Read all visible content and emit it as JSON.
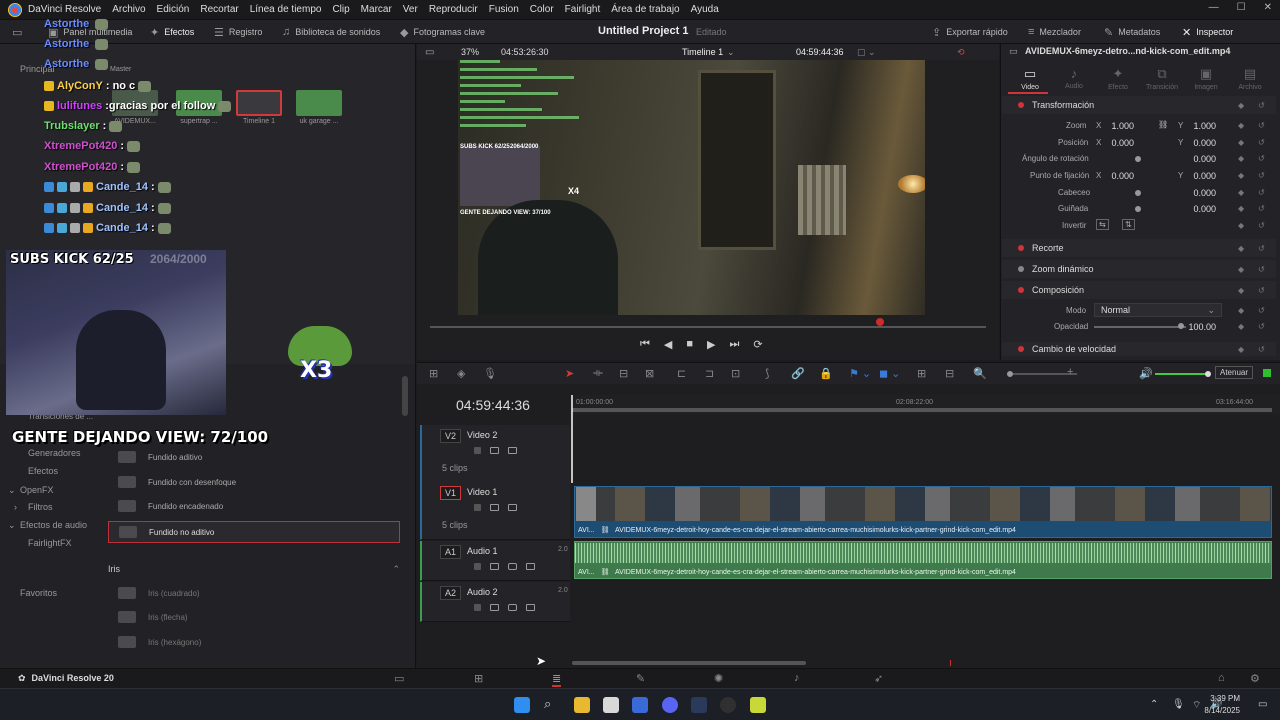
{
  "titlebar": {
    "menus": [
      "DaVinci Resolve",
      "Archivo",
      "Edición",
      "Recortar",
      "Línea de tiempo",
      "Clip",
      "Marcar",
      "Ver",
      "Reproducir",
      "Fusion",
      "Color",
      "Fairlight",
      "Área de trabajo",
      "Ayuda"
    ],
    "win_min": "—",
    "win_max": "☐",
    "win_close": "✕"
  },
  "toolbar": {
    "media_panel": "Panel multimedia",
    "effects": "Efectos",
    "register": "Registro",
    "sound_lib": "Biblioteca de sonidos",
    "keyframes": "Fotogramas clave",
    "project_title": "Untitled Project 1",
    "project_state": "Editado",
    "quick_export": "Exportar rápido",
    "mixer": "Mezclador",
    "metadata": "Metadatos",
    "inspector": "Inspector"
  },
  "media_pool": {
    "principal": "Principal",
    "master": "Master",
    "thumbs": [
      {
        "label": "AVIDEMUX...",
        "color": "#4a5a4a"
      },
      {
        "label": "supertrap ...",
        "color": "#4a8a4a"
      },
      {
        "label": "Timeline 1",
        "color": "#3a3a3e"
      },
      {
        "label": "uk garage ...",
        "color": "#4a8a4a"
      }
    ]
  },
  "chat": [
    {
      "user": "Astorthe",
      "msg": "",
      "color": "#6a8cff"
    },
    {
      "user": "Astorthe",
      "msg": "",
      "color": "#6a8cff"
    },
    {
      "user": "Astorthe",
      "msg": "",
      "color": "#6a8cff"
    },
    {
      "user": "AlyConY",
      "msg": ": no c",
      "color": "#ffd04a"
    },
    {
      "user": "lulifunes",
      "msg": ":gracias por el follow",
      "color": "#d040ff"
    },
    {
      "user": "Trubslayer",
      "msg": ":",
      "color": "#6ee06e"
    },
    {
      "user": "XtremePot420",
      "msg": ":",
      "color": "#d050d0"
    },
    {
      "user": "XtremePot420",
      "msg": ":",
      "color": "#d050d0"
    },
    {
      "user": "Cande_14",
      "msg": ":",
      "color": "#9ec2ff"
    },
    {
      "user": "Cande_14",
      "msg": ":",
      "color": "#9ec2ff"
    },
    {
      "user": "Cande_14",
      "msg": ":",
      "color": "#9ec2ff"
    }
  ],
  "webcam": {
    "subs": "SUBS KICK 62/25",
    "subs_faint": "2064/2000",
    "view": "GENTE DEJANDO VIEW: 72/100",
    "x3": "X3"
  },
  "effects": {
    "left_items": [
      "Transiciones de ...",
      "Generadores",
      "Efectos",
      "OpenFX",
      "Filtros",
      "Efectos de audio",
      "FairlightFX",
      "Favoritos"
    ],
    "transitions": [
      "Fundido aditivo",
      "Fundido con desenfoque",
      "Fundido encadenado",
      "Fundido no aditivo"
    ],
    "iris_header": "Iris",
    "iris": [
      "Iris (cuadrado)",
      "Iris (flecha)",
      "Iris (hexágono)"
    ]
  },
  "viewer": {
    "zoom": "37%",
    "timecode_left": "04:53:26:30",
    "timeline_name": "Timeline 1",
    "timecode_right": "04:59:44:36",
    "inner_subs": "SUBS KICK 62/25",
    "inner_count": "2064/2000",
    "inner_view": "GENTE DEJANDO VIEW: 37/100",
    "inner_x4": "X4",
    "scrub_fraction": 0.81
  },
  "inspector": {
    "file_name": "AVIDEMUX-6meyz-detro...nd-kick-com_edit.mp4",
    "tabs": [
      "Video",
      "Audio",
      "Efecto",
      "Transición",
      "Imagen",
      "Archivo"
    ],
    "transform": "Transformación",
    "zoom": {
      "label": "Zoom",
      "x": "1.000",
      "y": "1.000"
    },
    "position": {
      "label": "Posición",
      "x": "0.000",
      "y": "0.000"
    },
    "rotation": {
      "label": "Ángulo de rotación",
      "val": "0.000"
    },
    "anchor": {
      "label": "Punto de fijación",
      "x": "0.000",
      "y": "0.000"
    },
    "pitch": {
      "label": "Cabeceo",
      "val": "0.000"
    },
    "yaw": {
      "label": "Guiñada",
      "val": "0.000"
    },
    "invert": "Invertir",
    "crop": "Recorte",
    "dyn_zoom": "Zoom dinámico",
    "composition": "Composición",
    "mode_label": "Modo",
    "mode_val": "Normal",
    "opacity_label": "Opacidad",
    "opacity_val": "100.00",
    "speed": "Cambio de velocidad",
    "x_lbl": "X",
    "y_lbl": "Y"
  },
  "timeline": {
    "timecode": "04:59:44:36",
    "ruler": [
      "01:00:00:00",
      "02:08:22:00",
      "03:16:44:00"
    ],
    "mute_label": "Atenuar",
    "tracks": [
      {
        "id": "V2",
        "name": "Video 2",
        "clips": "5 clips"
      },
      {
        "id": "V1",
        "name": "Video 1",
        "clips": "5 clips"
      },
      {
        "id": "A1",
        "name": "Audio 1",
        "level": "2.0"
      },
      {
        "id": "A2",
        "name": "Audio 2",
        "level": "2.0"
      }
    ],
    "clip_name": "AVIDEMUX-6meyz-detroit-hoy-cande-es-cra-dejar-el-stream-abierto-carrea-muchisimolurks-kick-partner-grind-kick-com_edit.mp4",
    "clip_prefix": "AVI..."
  },
  "pagebar": {
    "brand": "DaVinci Resolve 20"
  },
  "taskbar": {
    "time": "3:39 PM",
    "date": "8/14/2025"
  }
}
